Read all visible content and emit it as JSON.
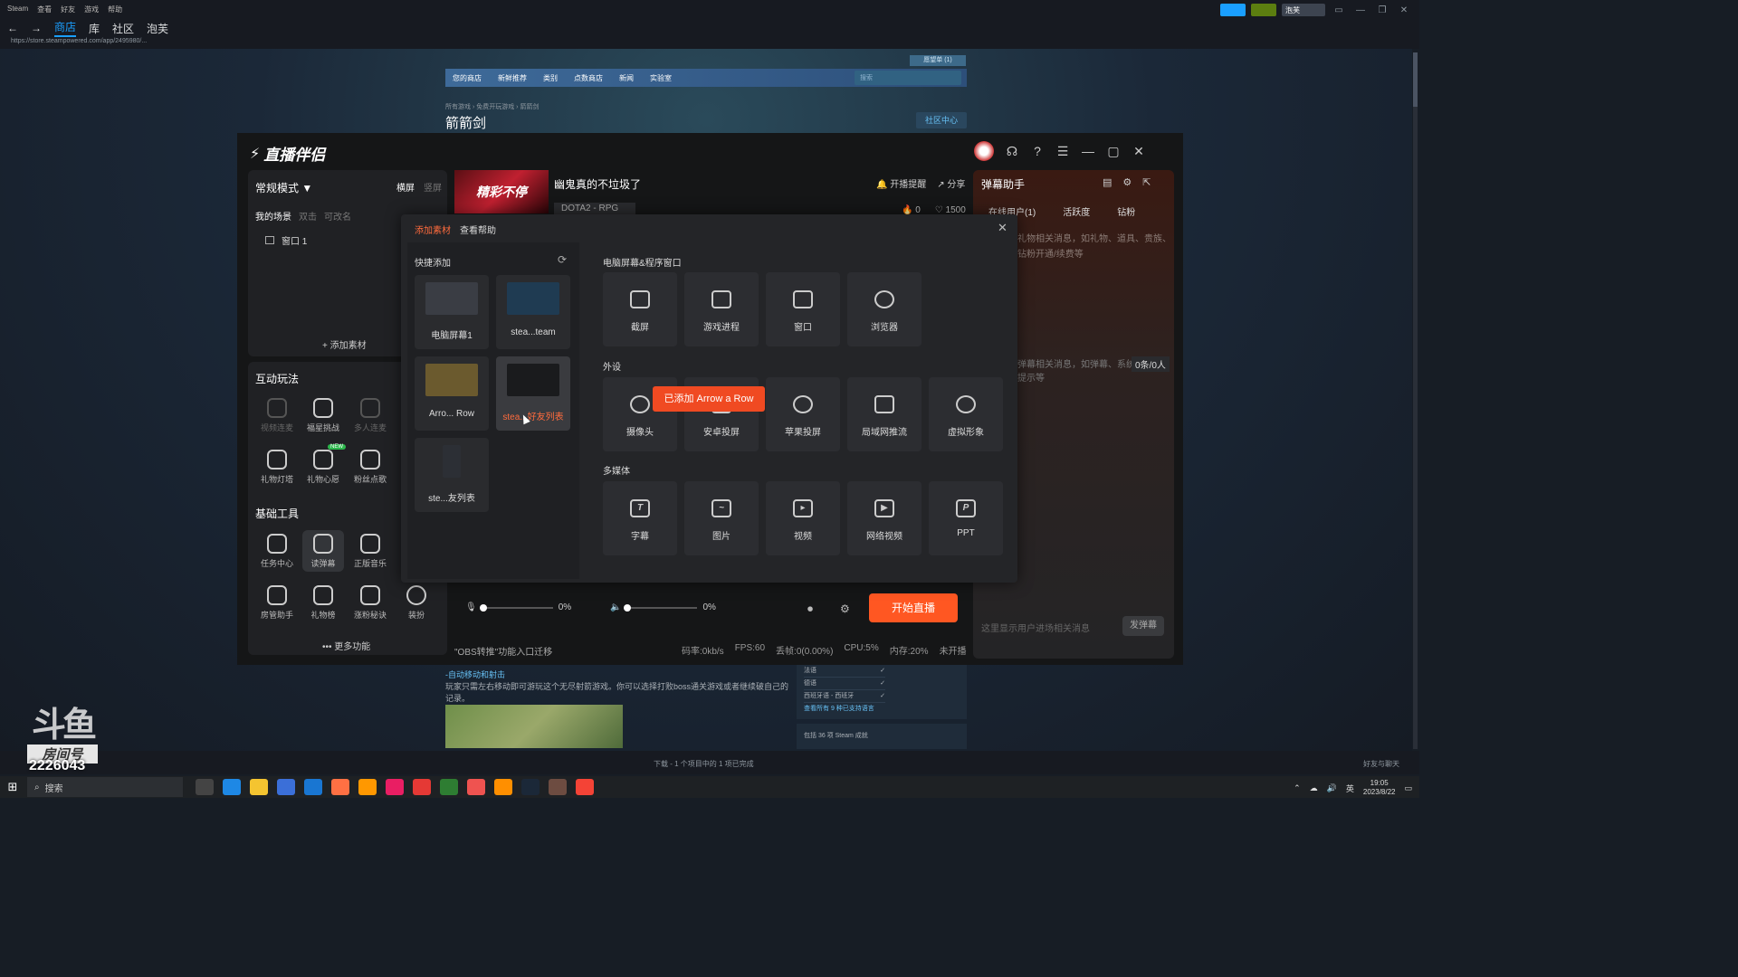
{
  "steam": {
    "menu": [
      "Steam",
      "查看",
      "好友",
      "游戏",
      "帮助"
    ],
    "nav": [
      "商店",
      "库",
      "社区",
      "泡芙"
    ],
    "url": "https://store.steampowered.com/app/2495980/...",
    "user": "泡芙",
    "store_nav": [
      "您的商店",
      "新鲜推荐",
      "类别",
      "点数商店",
      "新闻",
      "实验室"
    ],
    "search_placeholder": "搜索",
    "wishlist": "愿望单 (1)",
    "breadcrumb": "所有游戏 › 免费开玩游戏 › 箭箭剑",
    "game_title": "箭箭剑",
    "community_hub": "社区中心",
    "desc_heading": "-自动移动和射击",
    "desc_text": "玩家只需左右移动即可游玩这个无尽射箭游戏。你可以选择打败boss通关游戏或者继续破自己的记录。",
    "languages": [
      {
        "name": "法语",
        "check": "✓"
      },
      {
        "name": "德语",
        "check": "✓"
      },
      {
        "name": "西班牙语 - 西班牙",
        "check": "✓"
      }
    ],
    "lang_more": "查看所有 9 种已支持语言",
    "achievements": "包括 36 项 Steam 成就",
    "download_status": "下载 - 1 个项目中的 1 项已完成",
    "friends_chat": "好友与聊天"
  },
  "douyu": {
    "logo": "斗鱼",
    "room_label": "房间号",
    "room_number": "2226043"
  },
  "taskbar": {
    "search": "搜索",
    "lang": "英",
    "time": "19:05",
    "date": "2023/8/22"
  },
  "app": {
    "title": "直播伴侣",
    "mode": "常规模式 ▼",
    "screen_h": "横屏",
    "screen_v": "竖屏",
    "scene_tabs": [
      "我的场景",
      "双击",
      "可改名"
    ],
    "scene_item": "窗口 1",
    "add_material": "+ 添加素材",
    "interactive_h": "互动玩法",
    "interactive_tools": [
      {
        "label": "视频连麦",
        "dim": true
      },
      {
        "label": "福星挑战",
        "dim": false
      },
      {
        "label": "多人连麦",
        "dim": true
      },
      {
        "label": "礼物灯塔",
        "dim": false
      },
      {
        "label": "礼物心愿",
        "dim": false
      },
      {
        "label": "粉丝点歌",
        "dim": false
      }
    ],
    "new_badge": "NEW",
    "basic_h": "基础工具",
    "basic_tools": [
      "任务中心",
      "读弹幕",
      "正版音乐",
      "房管助手",
      "礼物榜",
      "涨粉秘诀",
      "装扮"
    ],
    "more_func": "••• 更多功能",
    "thumb_text": "精彩不停",
    "live_name": "幽鬼真的不垃圾了",
    "live_category": "DOTA2 - RPG",
    "live_remind": "开播提醒",
    "live_share": "分享",
    "fire": "0",
    "likes": "1500",
    "vol1": "0%",
    "vol2": "0%",
    "start_live": "开始直播",
    "obs_note": "\"OBS转推\"功能入口迁移",
    "status": [
      "码率:0kb/s",
      "FPS:60",
      "丢帧:0(0.00%)",
      "CPU:5%",
      "内存:20%",
      "未开播"
    ],
    "danmu_title": "弹幕助手",
    "danmu_tabs": [
      "在线用户(1)",
      "活跃度",
      "钻粉"
    ],
    "danmu_hint1": "礼物相关消息，如礼物、道具、贵族、钻粉开通/续费等",
    "danmu_hint2": "弹幕相关消息，如弹幕、系统提示等",
    "danmu_count": "0条/0人",
    "danmu_input": "这里显示用户进场相关消息",
    "danmu_send": "发弹幕"
  },
  "modal": {
    "tab_add": "添加素材",
    "tab_help": "查看帮助",
    "quick_h": "快捷添加",
    "quick_items": [
      {
        "label": "电脑屏幕1",
        "color": "#3a3d44"
      },
      {
        "label": "stea...team",
        "color": "#1f3b52"
      },
      {
        "label": "Arro... Row",
        "color": "#6b5a2e"
      },
      {
        "label": "stea...好友列表",
        "color": "#2a2c30"
      },
      {
        "label": "ste...友列表",
        "color": "#2c2f35"
      }
    ],
    "group_pc": "电脑屏幕&程序窗口",
    "pc_sources": [
      "截屏",
      "游戏进程",
      "窗口",
      "浏览器"
    ],
    "group_ext": "外设",
    "ext_sources": [
      "摄像头",
      "安卓投屏",
      "苹果投屏",
      "局域网推流",
      "虚拟形象"
    ],
    "group_media": "多媒体",
    "media_sources": [
      {
        "label": "字幕",
        "glyph": "T"
      },
      {
        "label": "图片",
        "glyph": "~"
      },
      {
        "label": "视频",
        "glyph": "▸"
      },
      {
        "label": "网络视频",
        "glyph": "▶"
      },
      {
        "label": "PPT",
        "glyph": "P"
      }
    ],
    "toast": "已添加 Arrow a Row"
  }
}
